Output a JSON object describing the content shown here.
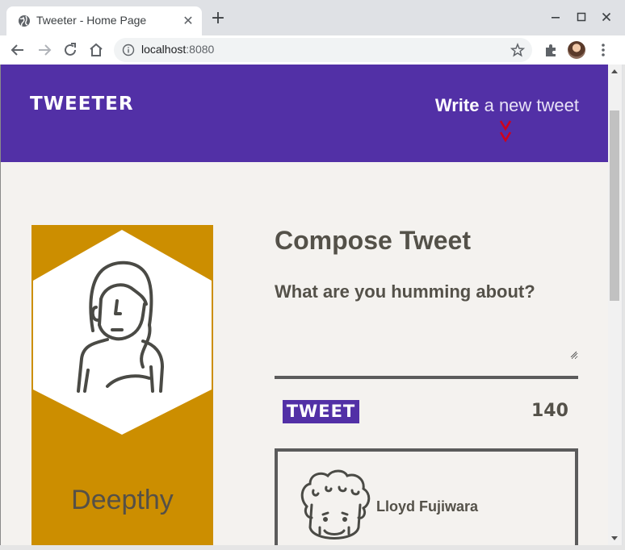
{
  "browser": {
    "tab_title": "Tweeter - Home Page",
    "url_host": "localhost",
    "url_port": ":8080"
  },
  "header": {
    "brand": "TWEETER",
    "write_bold": "Write",
    "write_rest": "a new tweet"
  },
  "profile": {
    "name": "Deepthy"
  },
  "compose": {
    "title": "Compose Tweet",
    "prompt": "What are you humming about?",
    "textarea_value": "",
    "button_label": "TWEET",
    "counter": "140"
  },
  "tweets": [
    {
      "author": "Lloyd Fujiwara"
    }
  ],
  "colors": {
    "brand_purple": "#5230a6",
    "card_gold": "#cc8e00",
    "page_bg": "#f4f2ef",
    "arrow_red": "#d0021b"
  }
}
